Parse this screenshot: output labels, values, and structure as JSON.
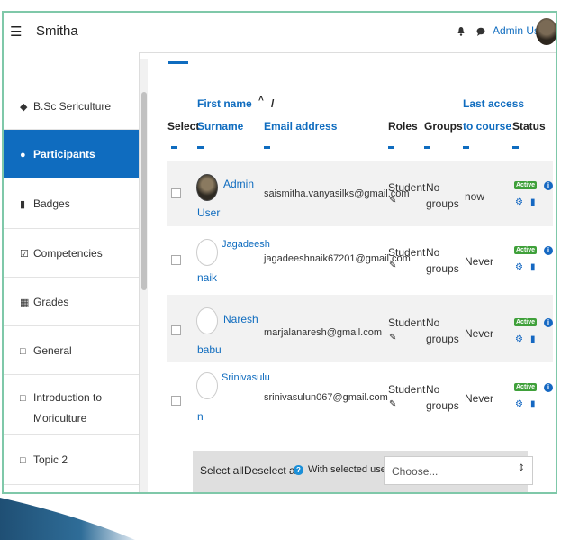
{
  "header": {
    "site_name": "Smitha",
    "user_name": "Admin User"
  },
  "sidebar": {
    "items": [
      {
        "label": "B.Sc Sericulture",
        "icon": "graduation-cap-icon"
      },
      {
        "label": "Participants",
        "icon": "users-icon",
        "active": true
      },
      {
        "label": "Badges",
        "icon": "shield-icon"
      },
      {
        "label": "Competencies",
        "icon": "check-square-icon"
      },
      {
        "label": "Grades",
        "icon": "table-icon"
      },
      {
        "label": "General",
        "icon": "folder-icon"
      },
      {
        "label": "Introduction to",
        "label2": "Moriculture",
        "icon": "folder-icon"
      },
      {
        "label": "Topic 2",
        "icon": "folder-icon"
      }
    ]
  },
  "table": {
    "headers": {
      "select": "Select",
      "first_name": "First name",
      "sort_arrow": "^",
      "slash": "/",
      "surname": "Surname",
      "email": "Email address",
      "roles": "Roles",
      "groups": "Groups",
      "last_access_1": "Last access",
      "last_access_2": "to course",
      "status": "Status"
    },
    "rows": [
      {
        "first": "Admin",
        "last": "User",
        "email": "saismitha.vanyasilks@gmail.com",
        "role": "Student",
        "groups_1": "No",
        "groups_2": "groups",
        "access": "now",
        "status": "Active"
      },
      {
        "first": "Jagadeesh",
        "last": "naik",
        "email": "jagadeeshnaik67201@gmail.com",
        "role": "Student",
        "groups_1": "No",
        "groups_2": "groups",
        "access": "Never",
        "status": "Active"
      },
      {
        "first": "Naresh",
        "last": "babu",
        "email": "marjalanaresh@gmail.com",
        "role": "Student",
        "groups_1": "No",
        "groups_2": "groups",
        "access": "Never",
        "status": "Active"
      },
      {
        "first": "Srinivasulu",
        "last": "n",
        "email": "srinivasulun067@gmail.com",
        "role": "Student",
        "groups_1": "No",
        "groups_2": "groups",
        "access": "Never",
        "status": "Active"
      }
    ]
  },
  "bulk": {
    "select_all": "Select all",
    "deselect_all": "Deselect all",
    "with_selected": "With selected users...",
    "choose": "Choose..."
  },
  "colors": {
    "accent": "#0f6cbf",
    "active_badge": "#3fa03a",
    "frame": "#7fc8a9"
  }
}
